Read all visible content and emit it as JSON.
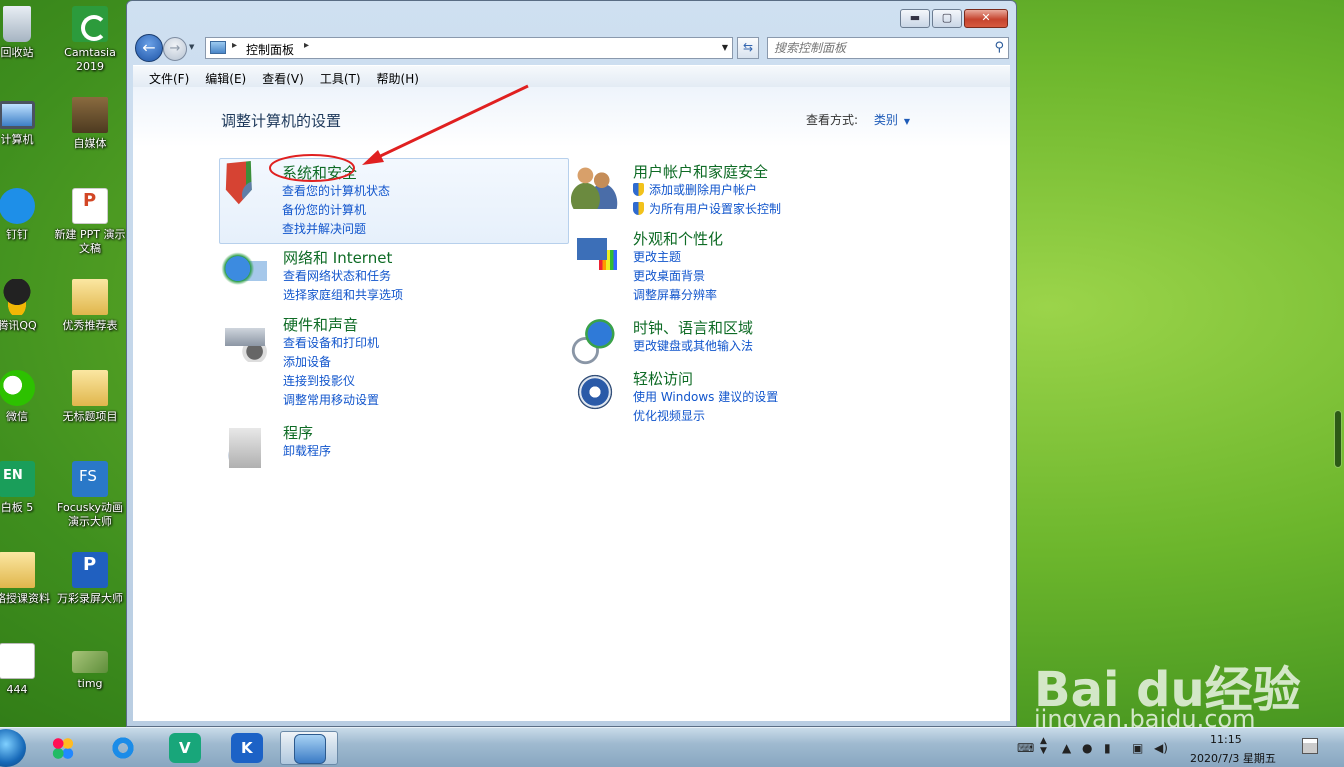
{
  "desktop": {
    "icons": [
      {
        "label": "回收站",
        "icon": "recycle-bin-icon"
      },
      {
        "label": "Camtasia 2019",
        "icon": "camtasia-icon"
      },
      {
        "label": "计算机",
        "icon": "computer-icon"
      },
      {
        "label": "自媒体",
        "icon": "folder-icon"
      },
      {
        "label": "钉钉",
        "icon": "dingtalk-icon"
      },
      {
        "label": "新建 PPT 演示文稿",
        "icon": "ppt-file-icon"
      },
      {
        "label": "腾讯QQ",
        "icon": "qq-icon"
      },
      {
        "label": "优秀推荐表",
        "icon": "folder-icon"
      },
      {
        "label": "微信",
        "icon": "wechat-icon"
      },
      {
        "label": "无标题项目",
        "icon": "folder-icon"
      },
      {
        "label": "白板 5",
        "icon": "whiteboard-icon"
      },
      {
        "label": "Focusky动画演示大师",
        "icon": "focusky-icon"
      },
      {
        "label": "网络授课资料",
        "icon": "folder-icon"
      },
      {
        "label": "万彩录屏大师",
        "icon": "wancai-icon"
      },
      {
        "label": "444",
        "icon": "file-icon"
      },
      {
        "label": "timg",
        "icon": "image-icon"
      }
    ]
  },
  "window": {
    "controls": {
      "minimize": "▬",
      "maximize": "▢",
      "close": "✕"
    },
    "address": {
      "crumb": "控制面板",
      "separator": "▸"
    },
    "search": {
      "placeholder": "搜索控制面板"
    },
    "menu": [
      "文件(F)",
      "编辑(E)",
      "查看(V)",
      "工具(T)",
      "帮助(H)"
    ],
    "heading": "调整计算机的设置",
    "view_by": {
      "label": "查看方式:",
      "value": "类别"
    },
    "categories": [
      {
        "title": "系统和安全",
        "icon": "system-security-icon",
        "links": [
          "查看您的计算机状态",
          "备份您的计算机",
          "查找并解决问题"
        ]
      },
      {
        "title": "用户帐户和家庭安全",
        "icon": "user-accounts-icon",
        "links": [
          "添加或删除用户帐户",
          "为所有用户设置家长控制"
        ]
      },
      {
        "title": "网络和 Internet",
        "icon": "network-icon",
        "links": [
          "查看网络状态和任务",
          "选择家庭组和共享选项"
        ]
      },
      {
        "title": "外观和个性化",
        "icon": "appearance-icon",
        "links": [
          "更改主题",
          "更改桌面背景",
          "调整屏幕分辨率"
        ]
      },
      {
        "title": "硬件和声音",
        "icon": "hardware-sound-icon",
        "links": [
          "查看设备和打印机",
          "添加设备",
          "连接到投影仪",
          "调整常用移动设置"
        ]
      },
      {
        "title": "时钟、语言和区域",
        "icon": "clock-region-icon",
        "links": [
          "更改键盘或其他输入法"
        ]
      },
      {
        "title": "轻松访问",
        "icon": "ease-of-access-icon",
        "links": [
          "使用 Windows 建议的设置",
          "优化视频显示"
        ]
      },
      {
        "title": "程序",
        "icon": "programs-icon",
        "links": [
          "卸载程序"
        ]
      }
    ]
  },
  "annotation": {
    "color": "#e02020"
  },
  "watermark": {
    "brand": "Bai du经验",
    "url": "jingyan.baidu.com"
  },
  "taskbar": {
    "items": [
      "start-orb",
      "palette-app-icon",
      "ie-icon",
      "v-app-icon",
      "k-app-icon",
      "control-panel-icon"
    ],
    "clock": {
      "time": "11:15",
      "date": "2020/7/3 星期五"
    }
  }
}
